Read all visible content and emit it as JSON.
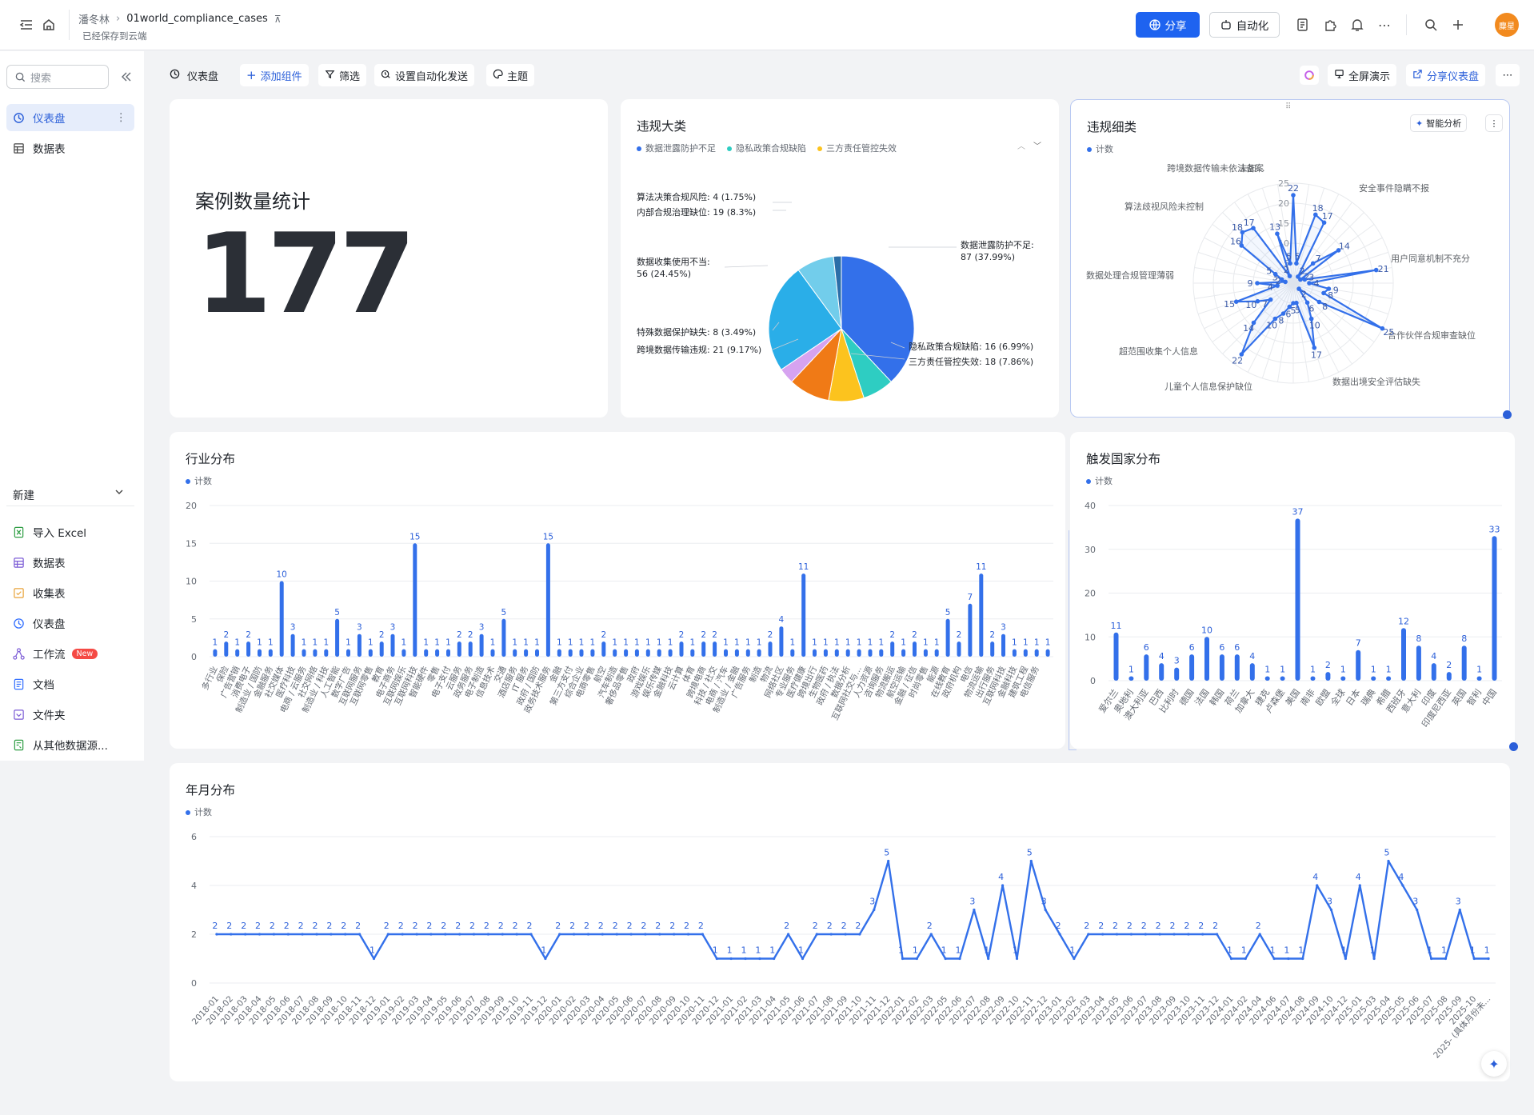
{
  "topbar": {
    "user": "潘冬林",
    "file_title": "01world_compliance_cases",
    "saved_status": "已经保存到云端",
    "share_label": "分享",
    "automation_label": "自动化",
    "avatar_text": "麋星"
  },
  "sidebar": {
    "search_placeholder": "搜索",
    "items": [
      {
        "label": "仪表盘",
        "icon": "dashboard-icon"
      },
      {
        "label": "数据表",
        "icon": "table-icon"
      }
    ],
    "new_section_label": "新建",
    "new_items": [
      {
        "label": "导入 Excel",
        "icon": "excel-icon",
        "color": "#2f9e44"
      },
      {
        "label": "数据表",
        "icon": "table-icon",
        "color": "#7c5cd6"
      },
      {
        "label": "收集表",
        "icon": "form-icon",
        "color": "#e8a33a"
      },
      {
        "label": "仪表盘",
        "icon": "dashboard-icon",
        "color": "#3370ff"
      },
      {
        "label": "工作流",
        "icon": "workflow-icon",
        "color": "#7c5cd6",
        "badge": "New"
      },
      {
        "label": "文档",
        "icon": "doc-icon",
        "color": "#3370ff"
      },
      {
        "label": "文件夹",
        "icon": "folder-icon",
        "color": "#7c5cd6"
      },
      {
        "label": "从其他数据源...",
        "icon": "datasource-icon",
        "color": "#2f9e44"
      }
    ]
  },
  "toolbar": {
    "dashboard_label": "仪表盘",
    "add_widget": "添加组件",
    "filter": "筛选",
    "auto_send": "设置自动化发送",
    "theme": "主题",
    "fullscreen": "全屏演示",
    "share_dashboard": "分享仪表盘"
  },
  "stat_card": {
    "title": "案例数量统计",
    "value": "177"
  },
  "pie_card": {
    "title": "违规大类",
    "legend": [
      {
        "name": "数据泄露防护不足",
        "color": "#3370ea"
      },
      {
        "name": "隐私政策合规缺陷",
        "color": "#2ecdc2"
      },
      {
        "name": "三方责任管控失效",
        "color": "#fcc31e"
      }
    ],
    "labels": [
      "算法决策合规风险: 4 (1.75%)",
      "内部合规治理缺位: 19 (8.3%)",
      "数据收集使用不当:",
      "56 (24.45%)",
      "特殊数据保护缺失: 8 (3.49%)",
      "跨境数据传输违规: 21 (9.17%)",
      "数据泄露防护不足:",
      "87 (37.99%)",
      "隐私政策合规缺陷: 16 (6.99%)",
      "三方责任管控失效: 18 (7.86%)"
    ]
  },
  "radar_card": {
    "title": "违规细类",
    "legend": "计数",
    "ai_button": "智能分析",
    "axes": [
      "未加...",
      "安全事件隐瞒不报",
      "用户同意机制不充分",
      "合作伙伴合规审查缺位",
      "数据出境安全评估缺失",
      "儿童个人信息保护缺位",
      "超范围收集个人信息",
      "数据处理合规管理薄弱",
      "算法歧视风险未控制",
      "跨境数据传输未依法备案"
    ],
    "ticks": [
      "25",
      "20",
      "15",
      "10",
      "5"
    ]
  },
  "chart_data": [
    {
      "type": "pie",
      "title": "违规大类",
      "categories": [
        "数据泄露防护不足",
        "隐私政策合规缺陷",
        "三方责任管控失效",
        "跨境数据传输违规",
        "特殊数据保护缺失",
        "数据收集使用不当",
        "内部合规治理缺位",
        "算法决策合规风险"
      ],
      "values": [
        87,
        16,
        18,
        21,
        8,
        56,
        19,
        4
      ],
      "colors": [
        "#3370ea",
        "#2ecdc2",
        "#fcc31e",
        "#f07a16",
        "#d6a3f0",
        "#2aaee8",
        "#72cdeb",
        "#2b6ea8"
      ]
    },
    {
      "type": "radar",
      "title": "违规细类",
      "series": [
        {
          "name": "计数",
          "values": [
            22,
            5,
            18,
            17,
            2,
            7,
            14,
            2,
            3,
            21,
            4,
            9,
            8,
            25,
            8,
            2,
            6,
            10,
            17,
            5,
            5,
            6,
            8,
            10,
            22,
            14,
            7,
            10,
            15,
            4,
            9,
            2,
            3,
            5,
            16,
            18,
            17,
            2,
            13,
            5
          ]
        }
      ],
      "ylim": [
        0,
        25
      ],
      "color": "#3370ea"
    },
    {
      "type": "bar",
      "title": "行业分布",
      "legend": "计数",
      "categories": [
        "多行业",
        "保险",
        "广告营销",
        "消费电子",
        "制造业 / 国防",
        "金融服务",
        "社交媒体",
        "医疗科技",
        "电商 / 云服务",
        "社交网络",
        "制造业 / 科技",
        "人工智能",
        "数字广告",
        "互联网服务",
        "互联网零售",
        "教育",
        "电子商务",
        "互联网娱乐",
        "互联网科技",
        "智能硬件",
        "零售",
        "电子支付",
        "云服务",
        "政务服务",
        "电子制造",
        "信息技术",
        "交通",
        "酒店服务",
        "IT 服务",
        "政府 / 国防",
        "政务技术服务",
        "金融",
        "第三方支付",
        "综合企业",
        "电商零售",
        "航空",
        "汽车制造",
        "奢侈品零售",
        "政府",
        "游戏娱乐",
        "娱乐传媒",
        "金融科技",
        "云计算",
        "体育",
        "跨境电商",
        "科技 / 社交",
        "电商 / 汽车",
        "制造业 / 金融",
        "广告服务",
        "制造",
        "物流",
        "网络社区",
        "专业服务",
        "医疗健康",
        "跨境出行",
        "生物医药",
        "政府 / 执法",
        "数据分析",
        "互联网社交与...",
        "人力资源",
        "咨询服务",
        "物流搬运",
        "航空运输",
        "金融 / 征信",
        "时尚零售",
        "能源",
        "在线教育",
        "政府机构",
        "电信",
        "物流运输",
        "出行服务",
        "互联网科技",
        "金融科技",
        "建筑工程",
        "电信服务"
      ],
      "values": [
        1,
        2,
        1,
        2,
        1,
        1,
        10,
        3,
        1,
        1,
        1,
        5,
        1,
        3,
        1,
        2,
        3,
        1,
        15,
        1,
        1,
        1,
        2,
        2,
        3,
        1,
        5,
        1,
        1,
        1,
        15,
        1,
        1,
        1,
        1,
        2,
        1,
        1,
        1,
        1,
        1,
        1,
        2,
        1,
        2,
        2,
        1,
        1,
        1,
        1,
        2,
        4,
        1,
        11,
        1,
        1,
        1,
        1,
        1,
        1,
        1,
        2,
        1,
        2,
        1,
        1,
        5,
        2,
        7,
        11,
        2,
        3,
        1,
        1,
        1,
        1
      ],
      "ylim": [
        0,
        20
      ],
      "color": "#3370ea"
    },
    {
      "type": "bar",
      "title": "触发国家分布",
      "legend": "计数",
      "categories": [
        "爱尔兰",
        "奥地利",
        "澳大利亚",
        "巴西",
        "比利时",
        "德国",
        "法国",
        "韩国",
        "荷兰",
        "加拿大",
        "捷克",
        "卢森堡",
        "美国",
        "南非",
        "欧盟",
        "全球",
        "日本",
        "瑞典",
        "希腊",
        "西班牙",
        "意大利",
        "印度",
        "印度尼西亚",
        "英国",
        "智利",
        "中国"
      ],
      "values": [
        11,
        1,
        6,
        4,
        3,
        6,
        10,
        6,
        6,
        4,
        1,
        1,
        37,
        1,
        2,
        1,
        7,
        1,
        1,
        12,
        8,
        4,
        2,
        8,
        1,
        33
      ],
      "ylim": [
        0,
        40
      ],
      "color": "#3370ea"
    },
    {
      "type": "line",
      "title": "年月分布",
      "legend": "计数",
      "x": [
        "2018-01",
        "2018-02",
        "2018-03",
        "2018-04",
        "2018-05",
        "2018-06",
        "2018-07",
        "2018-08",
        "2018-09",
        "2018-10",
        "2018-11",
        "2018-12",
        "2019-01",
        "2019-02",
        "2019-03",
        "2019-04",
        "2019-05",
        "2019-06",
        "2019-07",
        "2019-08",
        "2019-09",
        "2019-10",
        "2019-11",
        "2019-12",
        "2020-01",
        "2020-02",
        "2020-03",
        "2020-04",
        "2020-05",
        "2020-06",
        "2020-07",
        "2020-08",
        "2020-09",
        "2020-10",
        "2020-11",
        "2020-12",
        "2021-01",
        "2021-02",
        "2021-03",
        "2021-04",
        "2021-05",
        "2021-06",
        "2021-07",
        "2021-08",
        "2021-09",
        "2021-10",
        "2021-11",
        "2021-12",
        "2022-01",
        "2022-02",
        "2022-03",
        "2022-05",
        "2022-06",
        "2022-07",
        "2022-08",
        "2022-09",
        "2022-10",
        "2022-11",
        "2022-12",
        "2023-01",
        "2023-02",
        "2023-03",
        "2023-04",
        "2023-05",
        "2023-06",
        "2023-07",
        "2023-08",
        "2023-09",
        "2023-10",
        "2023-11",
        "2023-12",
        "2024-01",
        "2024-02",
        "2024-04",
        "2024-06",
        "2024-07",
        "2024-08",
        "2024-09",
        "2024-10",
        "2024-12",
        "2025-01",
        "2025-03",
        "2025-04",
        "2025-05",
        "2025-06",
        "2025-07",
        "2025-08",
        "2025-09",
        "2025-10",
        "2025- (具体月份未..."
      ],
      "values": [
        2,
        2,
        2,
        2,
        2,
        2,
        2,
        2,
        2,
        2,
        2,
        1,
        2,
        2,
        2,
        2,
        2,
        2,
        2,
        2,
        2,
        2,
        2,
        1,
        2,
        2,
        2,
        2,
        2,
        2,
        2,
        2,
        2,
        2,
        2,
        1,
        1,
        1,
        1,
        1,
        2,
        1,
        2,
        2,
        2,
        2,
        3,
        5,
        1,
        1,
        2,
        1,
        1,
        3,
        1,
        4,
        1,
        5,
        3,
        2,
        1,
        2,
        2,
        2,
        2,
        2,
        2,
        2,
        2,
        2,
        2,
        1,
        1,
        2,
        1,
        1,
        1,
        4,
        3,
        1,
        4,
        1,
        5,
        4,
        3,
        1,
        1,
        3,
        1,
        1
      ],
      "ylim": [
        0,
        6
      ],
      "color": "#3370ea"
    }
  ]
}
